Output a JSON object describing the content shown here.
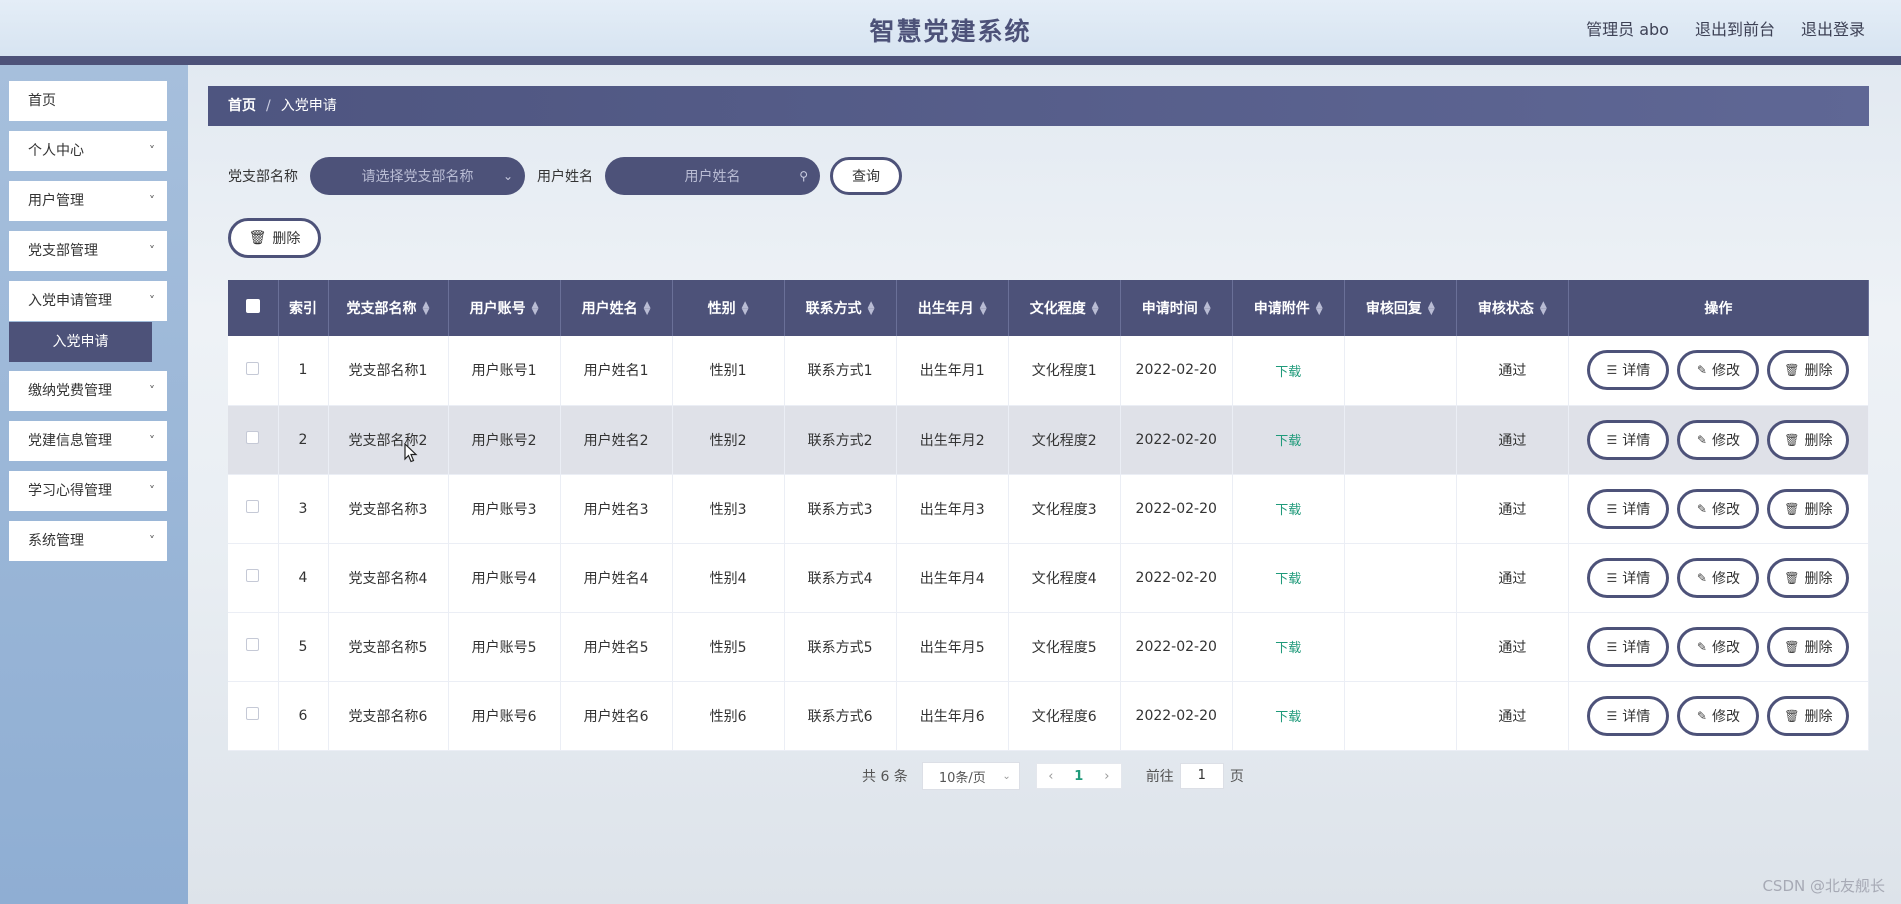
{
  "header": {
    "title": "智慧党建系统",
    "admin_label": "管理员 abo",
    "to_front": "退出到前台",
    "logout": "退出登录"
  },
  "sidebar": {
    "items": [
      {
        "label": "首页",
        "has_children": false
      },
      {
        "label": "个人中心",
        "has_children": true
      },
      {
        "label": "用户管理",
        "has_children": true
      },
      {
        "label": "党支部管理",
        "has_children": true
      },
      {
        "label": "入党申请管理",
        "has_children": true
      },
      {
        "label": "缴纳党费管理",
        "has_children": true
      },
      {
        "label": "党建信息管理",
        "has_children": true
      },
      {
        "label": "学习心得管理",
        "has_children": true
      },
      {
        "label": "系统管理",
        "has_children": true
      }
    ],
    "active_sub": "入党申请"
  },
  "breadcrumb": {
    "home": "首页",
    "separator": "/",
    "current": "入党申请"
  },
  "search": {
    "branch_label": "党支部名称",
    "branch_placeholder": "请选择党支部名称",
    "user_label": "用户姓名",
    "user_placeholder": "用户姓名",
    "query_button": "查询"
  },
  "toolbar": {
    "delete_label": "删除"
  },
  "table": {
    "columns": [
      "索引",
      "党支部名称",
      "用户账号",
      "用户姓名",
      "性别",
      "联系方式",
      "出生年月",
      "文化程度",
      "申请时间",
      "申请附件",
      "审核回复",
      "审核状态",
      "操作"
    ],
    "rows": [
      {
        "index": "1",
        "branch": "党支部名称1",
        "account": "用户账号1",
        "name": "用户姓名1",
        "gender": "性别1",
        "contact": "联系方式1",
        "birth": "出生年月1",
        "education": "文化程度1",
        "apply_time": "2022-02-20",
        "attachment": "下载",
        "reply": "",
        "status": "通过"
      },
      {
        "index": "2",
        "branch": "党支部名称2",
        "account": "用户账号2",
        "name": "用户姓名2",
        "gender": "性别2",
        "contact": "联系方式2",
        "birth": "出生年月2",
        "education": "文化程度2",
        "apply_time": "2022-02-20",
        "attachment": "下载",
        "reply": "",
        "status": "通过"
      },
      {
        "index": "3",
        "branch": "党支部名称3",
        "account": "用户账号3",
        "name": "用户姓名3",
        "gender": "性别3",
        "contact": "联系方式3",
        "birth": "出生年月3",
        "education": "文化程度3",
        "apply_time": "2022-02-20",
        "attachment": "下载",
        "reply": "",
        "status": "通过"
      },
      {
        "index": "4",
        "branch": "党支部名称4",
        "account": "用户账号4",
        "name": "用户姓名4",
        "gender": "性别4",
        "contact": "联系方式4",
        "birth": "出生年月4",
        "education": "文化程度4",
        "apply_time": "2022-02-20",
        "attachment": "下载",
        "reply": "",
        "status": "通过"
      },
      {
        "index": "5",
        "branch": "党支部名称5",
        "account": "用户账号5",
        "name": "用户姓名5",
        "gender": "性别5",
        "contact": "联系方式5",
        "birth": "出生年月5",
        "education": "文化程度5",
        "apply_time": "2022-02-20",
        "attachment": "下载",
        "reply": "",
        "status": "通过"
      },
      {
        "index": "6",
        "branch": "党支部名称6",
        "account": "用户账号6",
        "name": "用户姓名6",
        "gender": "性别6",
        "contact": "联系方式6",
        "birth": "出生年月6",
        "education": "文化程度6",
        "apply_time": "2022-02-20",
        "attachment": "下载",
        "reply": "",
        "status": "通过"
      }
    ],
    "actions": {
      "detail": "详情",
      "edit": "修改",
      "delete": "删除"
    }
  },
  "pagination": {
    "total_text": "共 6 条",
    "page_size": "10条/页",
    "current_page": "1",
    "goto_label": "前往",
    "goto_value": "1",
    "page_suffix": "页"
  },
  "watermark": "CSDN @北友舰长",
  "colors": {
    "primary": "#4d5279",
    "link_green": "#1f9a7a",
    "sidebar": "#97b3d8"
  }
}
